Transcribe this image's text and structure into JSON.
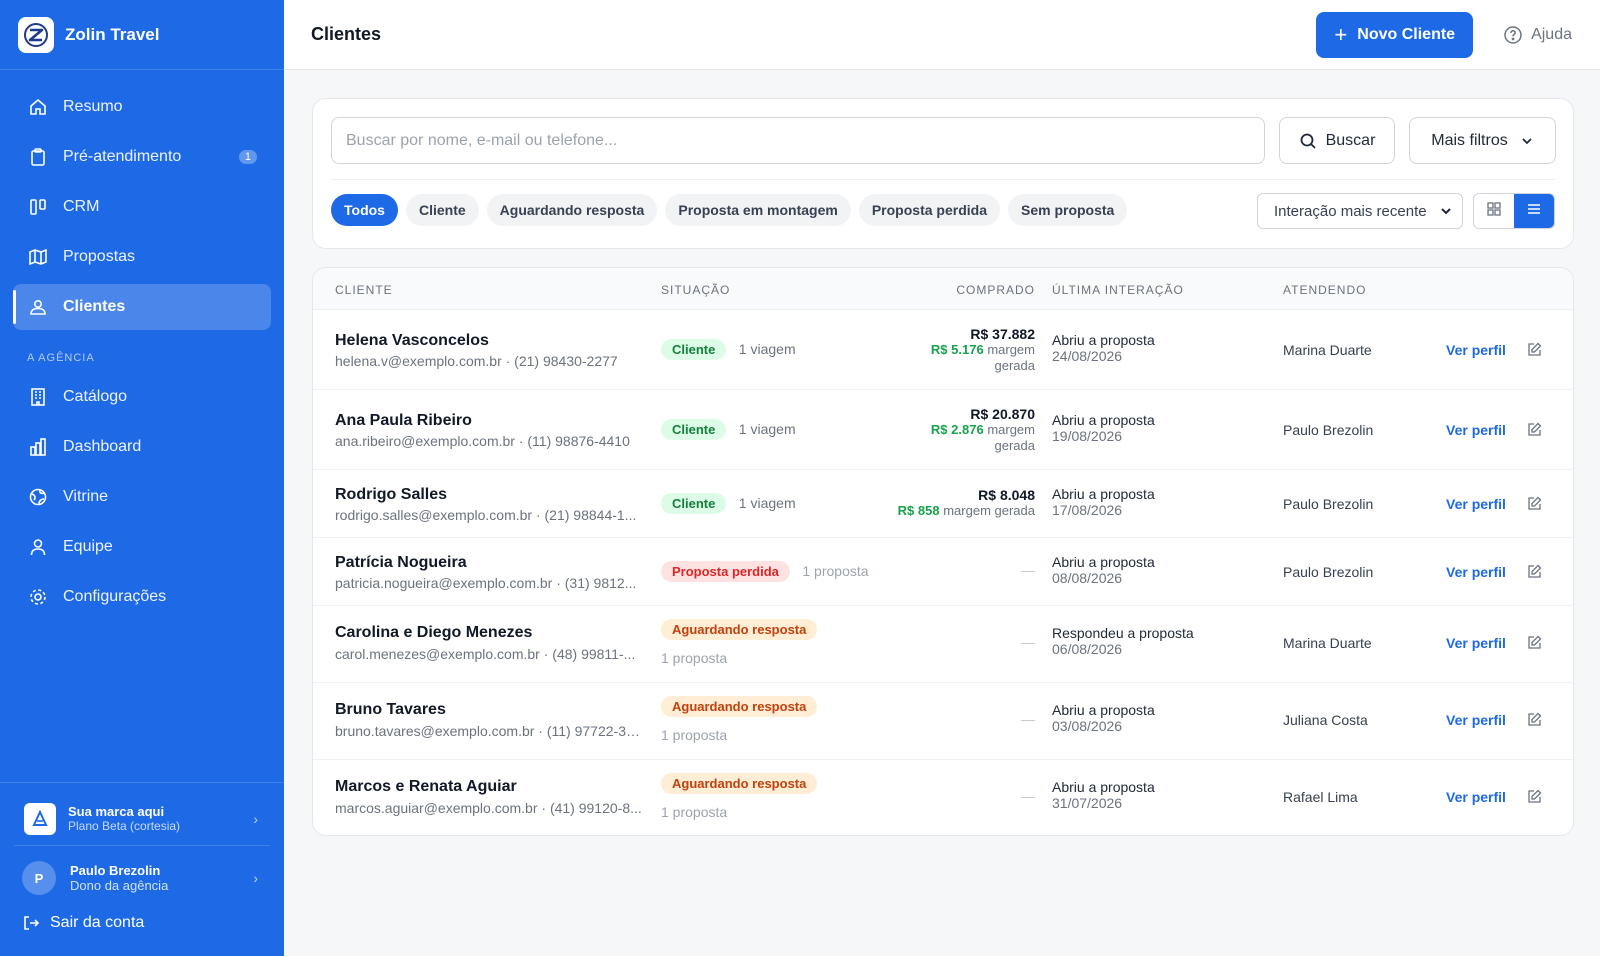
{
  "app": {
    "name": "Zolin Travel"
  },
  "sidebar": {
    "items": [
      {
        "label": "Resumo",
        "icon": "home-icon"
      },
      {
        "label": "Pré-atendimento",
        "icon": "clipboard-icon",
        "badge": "1"
      },
      {
        "label": "CRM",
        "icon": "kanban-icon"
      },
      {
        "label": "Propostas",
        "icon": "map-icon"
      },
      {
        "label": "Clientes",
        "icon": "users-icon",
        "active": true
      }
    ],
    "section_label": "A AGÊNCIA",
    "agency_items": [
      {
        "label": "Catálogo",
        "icon": "building-icon"
      },
      {
        "label": "Dashboard",
        "icon": "bar-chart-icon"
      },
      {
        "label": "Vitrine",
        "icon": "globe-icon"
      },
      {
        "label": "Equipe",
        "icon": "user-icon"
      },
      {
        "label": "Configurações",
        "icon": "gear-icon"
      }
    ],
    "brand_card": {
      "title": "Sua marca aqui",
      "subtitle": "Plano Beta (cortesia)"
    },
    "user": {
      "initial": "P",
      "name": "Paulo Brezolin",
      "role": "Dono da agência"
    },
    "logout_label": "Sair da conta"
  },
  "header": {
    "title": "Clientes",
    "new_button": "Novo Cliente",
    "help": "Ajuda"
  },
  "filters": {
    "search_placeholder": "Buscar por nome, e-mail ou telefone...",
    "search_button": "Buscar",
    "more_filters": "Mais filtros",
    "pills": [
      "Todos",
      "Cliente",
      "Aguardando resposta",
      "Proposta em montagem",
      "Proposta perdida",
      "Sem proposta"
    ],
    "active_pill": "Todos",
    "sort": "Interação mais recente",
    "view": "list"
  },
  "table": {
    "headers": {
      "cliente": "CLIENTE",
      "situacao": "SITUAÇÃO",
      "comprado": "COMPRADO",
      "ultima": "ÚLTIMA INTERAÇÃO",
      "atendendo": "ATENDENDO"
    },
    "view_profile": "Ver perfil",
    "rows": [
      {
        "name": "Helena Vasconcelos",
        "contact": "helena.v@exemplo.com.br · (21) 98430-2277",
        "status": "Cliente",
        "status_note": "1 viagem",
        "amount": "R$ 37.882",
        "margin": "R$ 5.176",
        "margin_label_1": "margem",
        "margin_label_2": "gerada",
        "interaction": "Abriu a proposta",
        "date": "24/08/2026",
        "agent": "Marina Duarte"
      },
      {
        "name": "Ana Paula Ribeiro",
        "contact": "ana.ribeiro@exemplo.com.br · (11) 98876-4410",
        "status": "Cliente",
        "status_note": "1 viagem",
        "amount": "R$ 20.870",
        "margin": "R$ 2.876",
        "margin_label_1": "margem",
        "margin_label_2": "gerada",
        "interaction": "Abriu a proposta",
        "date": "19/08/2026",
        "agent": "Paulo Brezolin"
      },
      {
        "name": "Rodrigo Salles",
        "contact": "rodrigo.salles@exemplo.com.br · (21) 98844-1...",
        "status": "Cliente",
        "status_note": "1 viagem",
        "amount": "R$ 8.048",
        "margin": "R$ 858",
        "margin_label_1": "margem gerada",
        "interaction": "Abriu a proposta",
        "date": "17/08/2026",
        "agent": "Paulo Brezolin"
      },
      {
        "name": "Patrícia Nogueira",
        "contact": "patricia.nogueira@exemplo.com.br · (31) 9812...",
        "status": "Proposta perdida",
        "status_note": "1 proposta",
        "amount": "—",
        "interaction": "Abriu a proposta",
        "date": "08/08/2026",
        "agent": "Paulo Brezolin"
      },
      {
        "name": "Carolina e Diego Menezes",
        "contact": "carol.menezes@exemplo.com.br · (48) 99811-...",
        "status": "Aguardando resposta",
        "status_note": "1 proposta",
        "amount": "—",
        "interaction": "Respondeu a proposta",
        "date": "06/08/2026",
        "agent": "Marina Duarte"
      },
      {
        "name": "Bruno Tavares",
        "contact": "bruno.tavares@exemplo.com.br · (11) 97722-31...",
        "status": "Aguardando resposta",
        "status_note": "1 proposta",
        "amount": "—",
        "interaction": "Abriu a proposta",
        "date": "03/08/2026",
        "agent": "Juliana Costa"
      },
      {
        "name": "Marcos e Renata Aguiar",
        "contact": "marcos.aguiar@exemplo.com.br · (41) 99120-8...",
        "status": "Aguardando resposta",
        "status_note": "1 proposta",
        "amount": "—",
        "interaction": "Abriu a proposta",
        "date": "31/07/2026",
        "agent": "Rafael Lima"
      }
    ]
  },
  "colors": {
    "primary": "#1e6ae6",
    "success": "#16a34a",
    "danger": "#dc2626",
    "warning": "#c2410c"
  }
}
